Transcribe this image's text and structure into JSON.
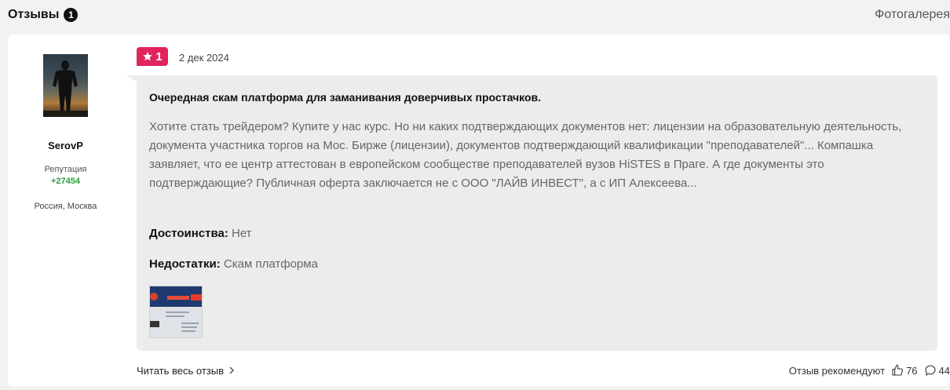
{
  "header": {
    "title": "Отзывы",
    "count": "1",
    "gallery_label": "Фотогалерея"
  },
  "author": {
    "username": "SerovP",
    "reputation_label": "Репутация",
    "reputation_value": "+27454",
    "location": "Россия, Москва"
  },
  "review": {
    "rating": "1",
    "date": "2 дек 2024",
    "title": "Очередная скам платформа для заманивания доверчивых простачков.",
    "text": "Хотите стать трейдером? Купите у нас курс. Но ни каких подтверждающих документов нет: лицензии на образовательную деятельность, документа участника торгов на Мос. Бирже (лицензии), документов подтверждающий квалификации \"преподавателей\"... Компашка заявляет, что ее центр аттестован в европейском сообществе преподавателей вузов HiSTES в Праге. А где документы это подтверждающие? Публичная оферта заключается не с ООО \"ЛАЙВ ИНВЕСТ\", а с ИП Алексеева...",
    "pros_label": "Достоинства:",
    "pros_value": "Нет",
    "cons_label": "Недостатки:",
    "cons_value": "Скам платформа"
  },
  "footer": {
    "read_all": "Читать весь отзыв",
    "recommend_label": "Отзыв рекомендуют",
    "likes": "76",
    "comments": "44"
  },
  "colors": {
    "rating_badge": "#e0245e",
    "reputation": "#2a9d3a",
    "bubble_bg": "#ececec"
  },
  "icons": [
    "star-icon",
    "chevron-right-icon",
    "thumbs-up-icon",
    "comment-icon"
  ]
}
